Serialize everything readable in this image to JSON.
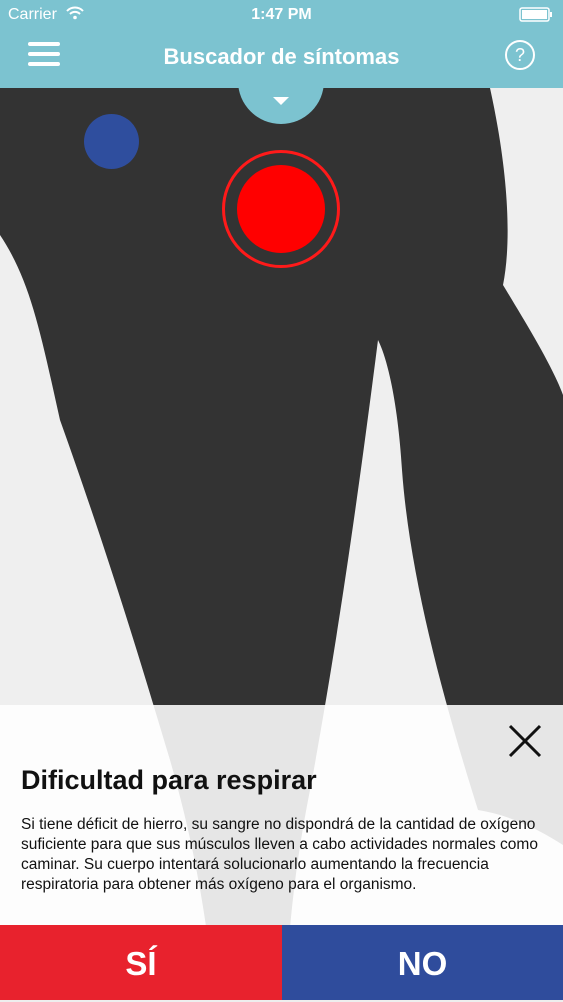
{
  "status_bar": {
    "carrier": "Carrier",
    "time": "1:47 PM"
  },
  "nav": {
    "title": "Buscador de síntomas",
    "help_label": "?"
  },
  "symptom": {
    "title": "Dificultad para respirar",
    "description": "Si tiene déficit de hierro, su sangre no dispondrá de la cantidad de oxígeno suficiente para que sus músculos lleven a cabo actividades normales como caminar. Su cuerpo intentará solucionarlo aumentando la frecuencia respiratoria para obtener más oxígeno para el organismo."
  },
  "answers": {
    "yes": "SÍ",
    "no": "NO"
  },
  "colors": {
    "header": "#7cc3d0",
    "body_silhouette": "#333333",
    "active_marker": "#ff0000",
    "secondary_marker": "#2f4e9e",
    "yes_button": "#e8222d",
    "no_button": "#2f4c9c"
  },
  "icons": [
    "wifi-icon",
    "battery-icon",
    "menu-icon",
    "help-icon",
    "chevron-down-icon",
    "close-icon"
  ]
}
